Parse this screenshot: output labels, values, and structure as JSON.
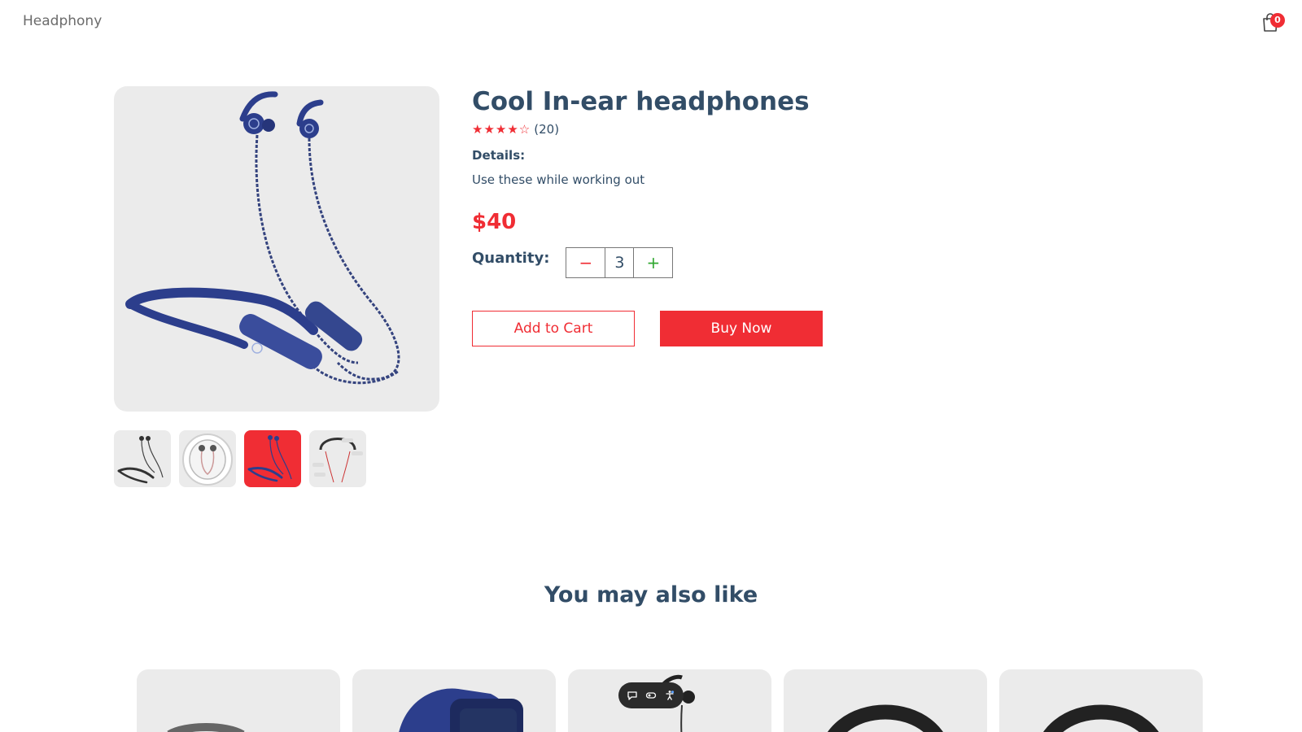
{
  "navbar": {
    "logo": "Headphony",
    "cart_count": "0"
  },
  "product": {
    "title": "Cool In-ear headphones",
    "stars": "★★★★☆",
    "rating": 4,
    "review_count": "(20)",
    "details_label": "Details:",
    "details_text": "Use these while working out",
    "price": "$40"
  },
  "quantity": {
    "label": "Quantity:",
    "minus": "−",
    "plus": "+",
    "value": "3"
  },
  "actions": {
    "add_to_cart": "Add to Cart",
    "buy_now": "Buy Now"
  },
  "thumbnails": {
    "selected_index": 2,
    "count": 4
  },
  "recommendations": {
    "title": "You may also like"
  },
  "colors": {
    "accent": "#f02d34",
    "text": "#324d67",
    "image_bg": "#ebebeb",
    "product_blue": "#2c3e8c"
  }
}
